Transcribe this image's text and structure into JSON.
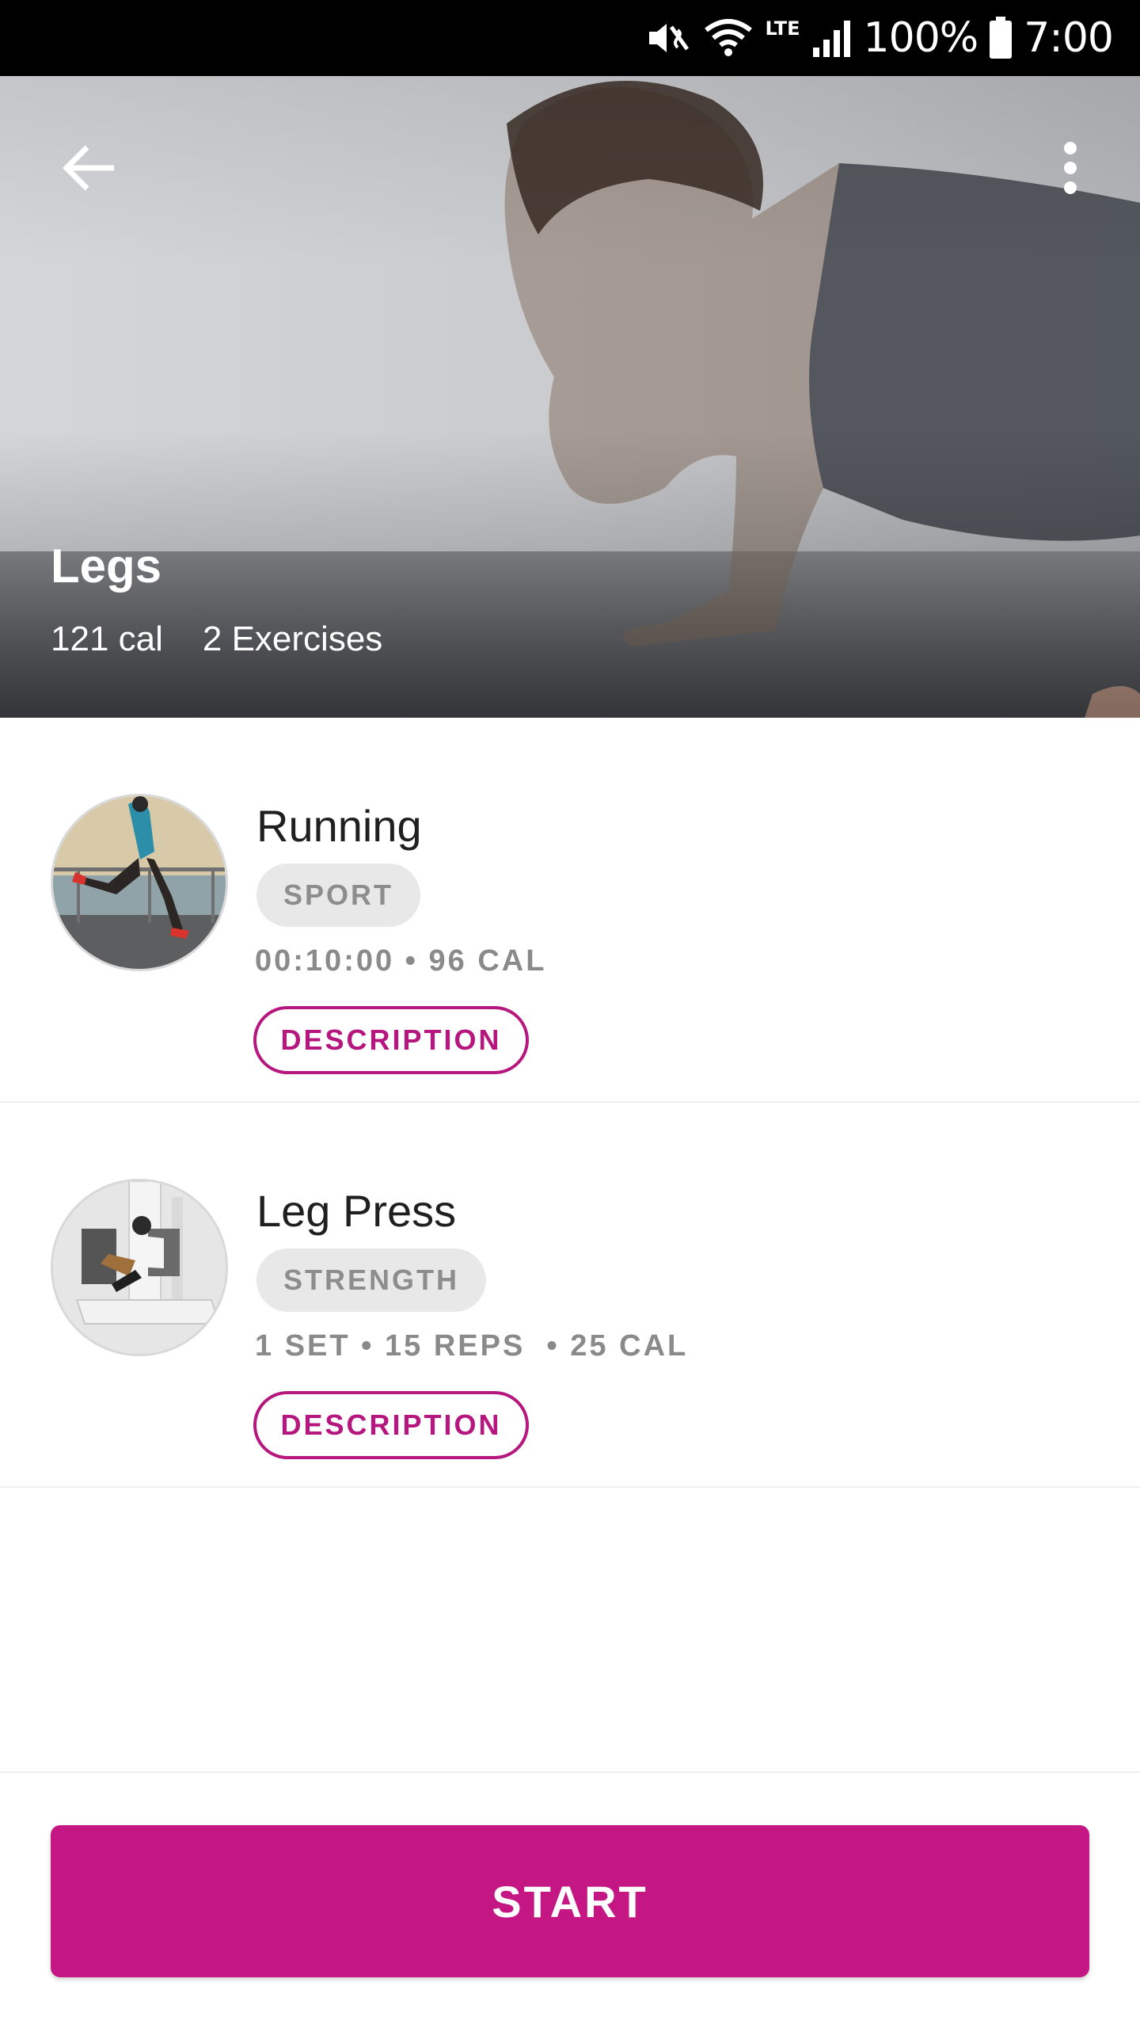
{
  "status_bar": {
    "battery": "100%",
    "time": "7:00",
    "network": "LTE",
    "icons": [
      "mute-vibrate-icon",
      "wifi-icon",
      "lte-icon",
      "signal-icon",
      "battery-icon"
    ]
  },
  "header": {
    "back_icon": "arrow-left-icon",
    "more_icon": "more-vertical-icon"
  },
  "workout": {
    "title": "Legs",
    "calories": "121 cal",
    "exercise_count": "2 Exercises"
  },
  "exercises": [
    {
      "name": "Running",
      "category": "SPORT",
      "stats": "00:10:00 • 96 CAL",
      "button_label": "DESCRIPTION"
    },
    {
      "name": "Leg Press",
      "category": "STRENGTH",
      "stats": "1 SET • 15 REPS  • 25 CAL",
      "button_label": "DESCRIPTION"
    }
  ],
  "footer": {
    "start_label": "START"
  },
  "colors": {
    "accent": "#c41783",
    "accent_outline": "#b5177f",
    "tag_bg": "#e8e8e8",
    "tag_text": "#8d8d8d"
  }
}
